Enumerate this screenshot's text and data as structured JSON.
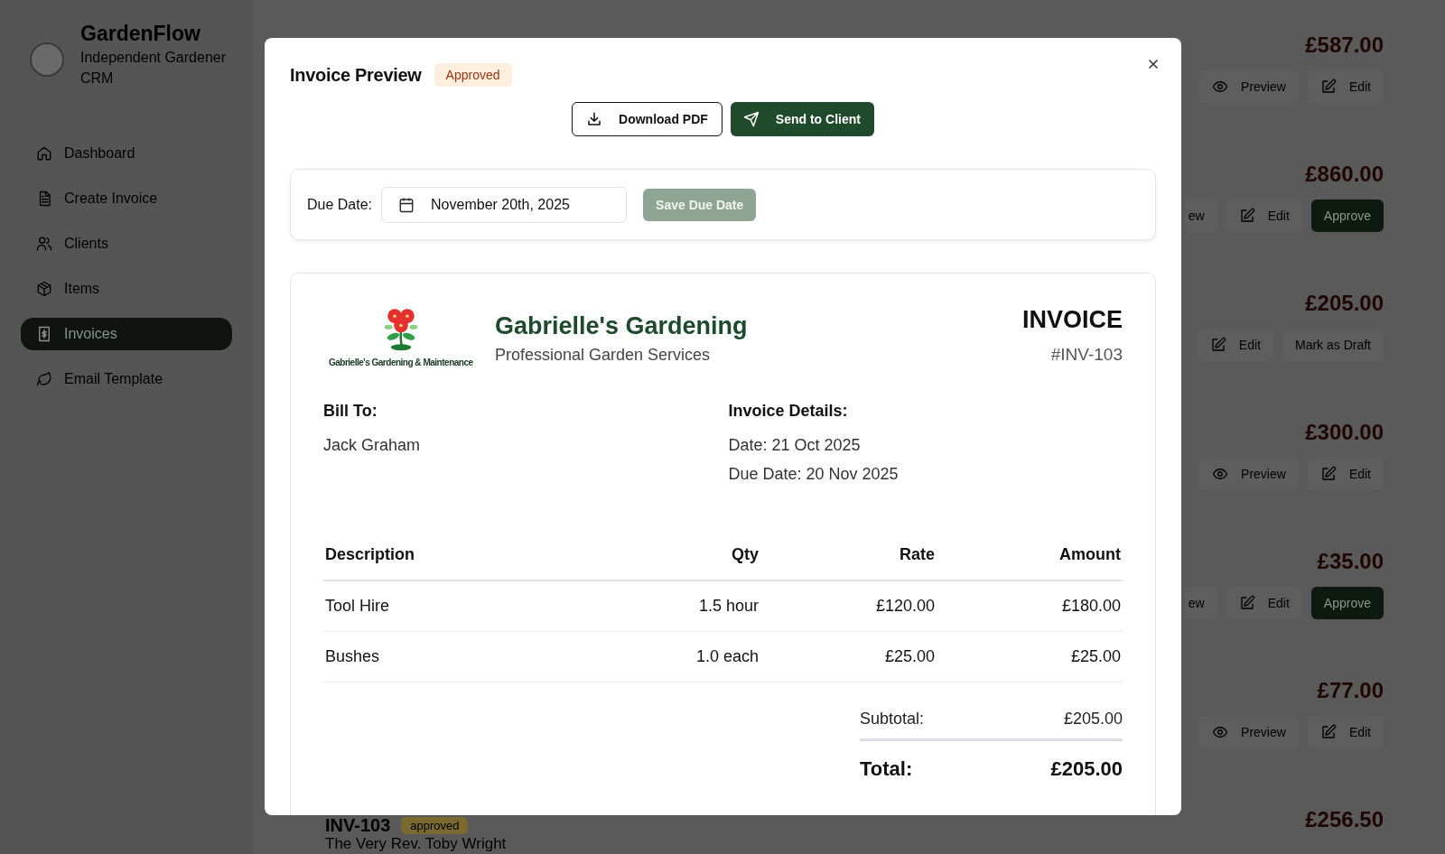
{
  "sidebar": {
    "app_name": "GardenFlow",
    "subtitle": "Independent Gardener CRM",
    "nav": [
      {
        "label": "Dashboard",
        "selected": false
      },
      {
        "label": "Create Invoice",
        "selected": false
      },
      {
        "label": "Clients",
        "selected": false
      },
      {
        "label": "Items",
        "selected": false
      },
      {
        "label": "Invoices",
        "selected": true
      },
      {
        "label": "Email Template",
        "selected": false
      }
    ]
  },
  "invoice_list": [
    {
      "amount": "£587.00",
      "actions": [
        {
          "kind": "preview",
          "label": "Preview"
        },
        {
          "kind": "edit",
          "label": "Edit"
        }
      ]
    },
    {
      "amount": "£860.00",
      "actions": [
        {
          "kind": "partial",
          "label": "ew"
        },
        {
          "kind": "edit",
          "label": "Edit"
        },
        {
          "kind": "approve",
          "label": "Approve"
        }
      ]
    },
    {
      "amount": "£205.00",
      "actions": [
        {
          "kind": "edit",
          "label": "Edit"
        },
        {
          "kind": "plain",
          "label": "Mark as Draft"
        }
      ]
    },
    {
      "amount": "£300.00",
      "actions": [
        {
          "kind": "preview",
          "label": "Preview"
        },
        {
          "kind": "edit",
          "label": "Edit"
        }
      ]
    },
    {
      "amount": "£35.00",
      "actions": [
        {
          "kind": "partial",
          "label": "ew"
        },
        {
          "kind": "edit",
          "label": "Edit"
        },
        {
          "kind": "approve",
          "label": "Approve"
        }
      ]
    },
    {
      "amount": "£77.00",
      "actions": [
        {
          "kind": "preview",
          "label": "Preview"
        },
        {
          "kind": "edit",
          "label": "Edit"
        }
      ]
    },
    {
      "number": "INV-103",
      "status": "approved",
      "client": "The Very Rev. Toby Wright",
      "amount": "£256.50"
    }
  ],
  "modal": {
    "title": "Invoice Preview",
    "status": "Approved",
    "buttons": [
      {
        "kind": "download",
        "label": "Download PDF"
      },
      {
        "kind": "send",
        "label": "Send to Client"
      }
    ],
    "due_date": {
      "label": "Due Date:",
      "value": "November 20th, 2025",
      "button": "Save Due Date",
      "disabled": true
    },
    "invoice": {
      "logo_caption": "Gabrielle's Gardening & Maintenance",
      "company": "Gabrielle's Gardening",
      "tagline": "Professional Garden Services",
      "heading": "INVOICE",
      "number": "#INV-103",
      "bill_to_label": "Bill To:",
      "client": "Jack Graham",
      "details_label": "Invoice Details:",
      "details": [
        "Date: 21 Oct 2025",
        "Due Date: 20 Nov 2025"
      ],
      "columns": [
        "Description",
        "Qty",
        "Rate",
        "Amount"
      ],
      "rows": [
        [
          "Tool Hire",
          "1.5 hour",
          "£120.00",
          "£180.00"
        ],
        [
          "Bushes",
          "1.0 each",
          "£25.00",
          "£25.00"
        ]
      ],
      "subtotal_label": "Subtotal:",
      "subtotal": "£205.00",
      "total_label": "Total:",
      "total": "£205.00"
    }
  }
}
